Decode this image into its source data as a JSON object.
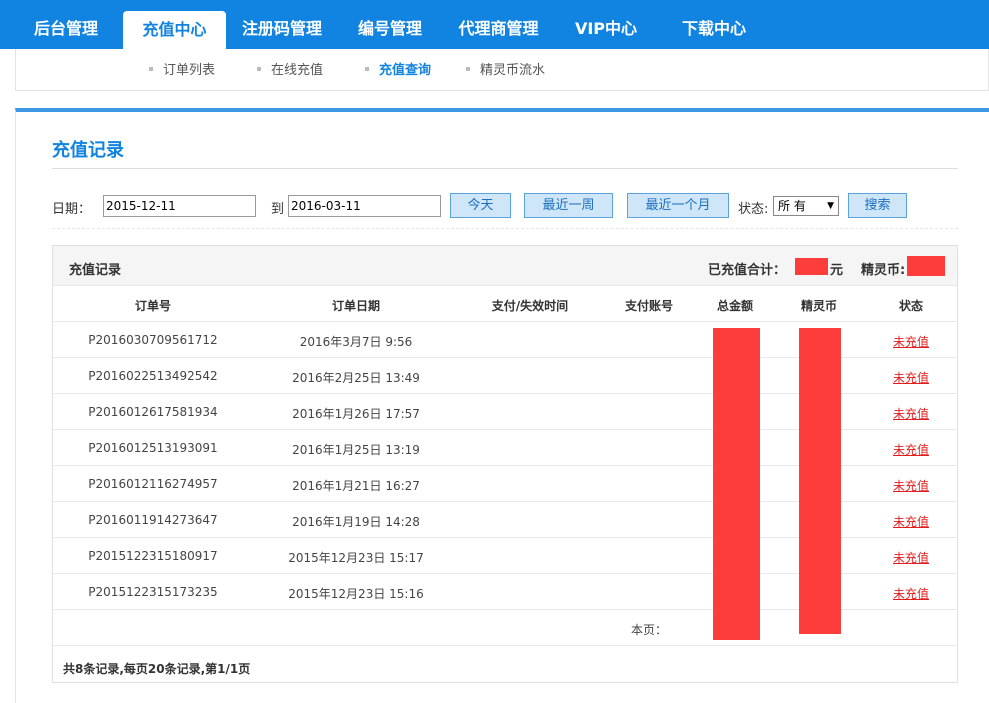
{
  "nav": {
    "tabs": [
      {
        "label": "后台管理"
      },
      {
        "label": "充值中心"
      },
      {
        "label": "注册码管理"
      },
      {
        "label": "编号管理"
      },
      {
        "label": "代理商管理"
      },
      {
        "label": "VIP中心"
      },
      {
        "label": "下载中心"
      }
    ],
    "active_tab": "充值中心"
  },
  "subnav": {
    "items": [
      {
        "label": "订单列表"
      },
      {
        "label": "在线充值"
      },
      {
        "label": "充值查询"
      },
      {
        "label": "精灵币流水"
      }
    ],
    "active": "充值查询"
  },
  "page": {
    "title": "充值记录"
  },
  "filter": {
    "date_label": "日期：",
    "start_date": "2015-12-11",
    "to_label": "到",
    "end_date": "2016-03-11",
    "btn_today": "今天",
    "btn_week": "最近一周",
    "btn_month": "最近一个月",
    "status_label": "状态:",
    "status_value": "所 有",
    "btn_search": "搜索"
  },
  "records": {
    "title": "充值记录",
    "total_label": "已充值合计：",
    "total_unit": "元",
    "coin_label": "精灵币:",
    "columns": {
      "order_no": "订单号",
      "order_date": "订单日期",
      "pay_time": "支付/失效时间",
      "pay_account": "支付账号",
      "amount": "总金额",
      "coins": "精灵币",
      "status": "状态"
    },
    "rows": [
      {
        "order_no": "P2016030709561712",
        "order_date": "2016年3月7日 9:56",
        "status": "未充值"
      },
      {
        "order_no": "P2016022513492542",
        "order_date": "2016年2月25日 13:49",
        "status": "未充值"
      },
      {
        "order_no": "P2016012617581934",
        "order_date": "2016年1月26日 17:57",
        "status": "未充值"
      },
      {
        "order_no": "P2016012513193091",
        "order_date": "2016年1月25日 13:19",
        "status": "未充值"
      },
      {
        "order_no": "P2016012116274957",
        "order_date": "2016年1月21日 16:27",
        "status": "未充值"
      },
      {
        "order_no": "P2016011914273647",
        "order_date": "2016年1月19日 14:28",
        "status": "未充值"
      },
      {
        "order_no": "P2015122315180917",
        "order_date": "2015年12月23日 15:17",
        "status": "未充值"
      },
      {
        "order_no": "P2015122315173235",
        "order_date": "2015年12月23日 15:16",
        "status": "未充值"
      }
    ],
    "page_label": "本页：",
    "pager": "共8条记录,每页20条记录,第1/1页"
  },
  "colors": {
    "primary": "#1183e0",
    "redaction": "#fd3c3c",
    "status_link": "#e21d1d"
  }
}
